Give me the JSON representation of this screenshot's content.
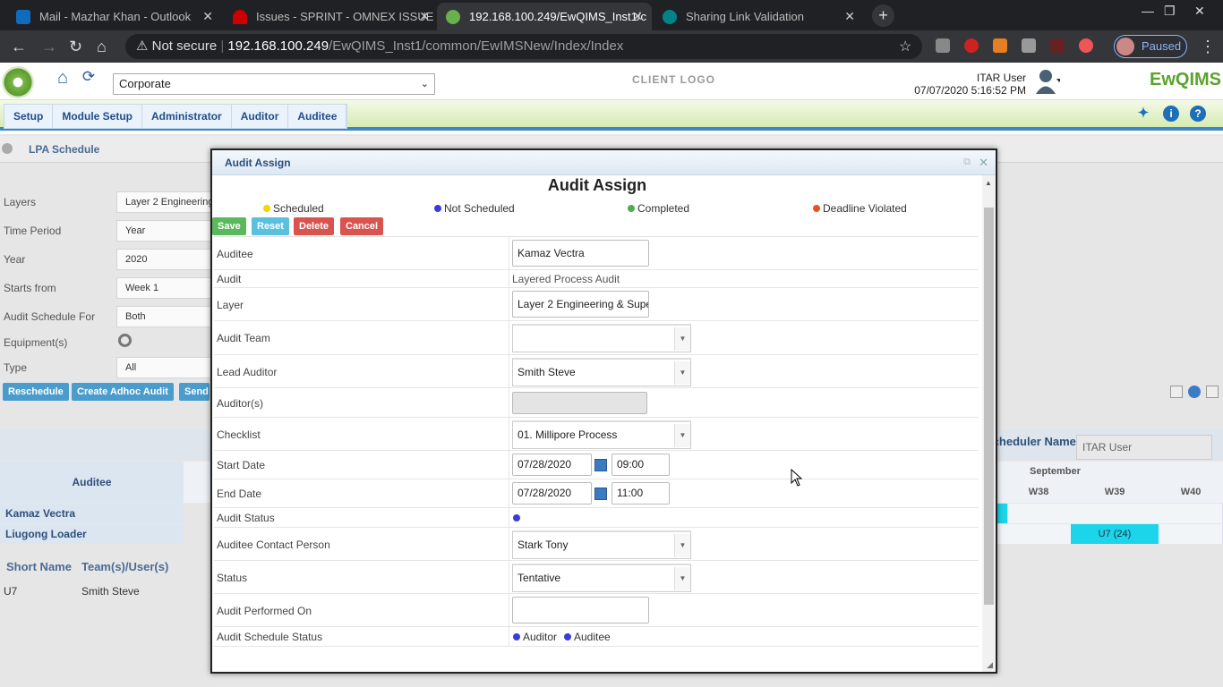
{
  "browser": {
    "tabs": [
      {
        "title": "Mail - Mazhar Khan - Outlook",
        "color": "#0f6cbd"
      },
      {
        "title": "Issues - SPRINT - OMNEX ISSUE",
        "color": "#c00"
      },
      {
        "title": "192.168.100.249/EwQIMS_Inst1/c",
        "color": "#6ab04c"
      },
      {
        "title": "Sharing Link Validation",
        "color": "#038387"
      }
    ],
    "security": "Not secure",
    "url_host": "192.168.100.249",
    "url_path": "/EwQIMS_Inst1/common/EwIMSNew/Index/Index",
    "paused": "Paused"
  },
  "app": {
    "site_select": "Corporate",
    "client_logo": "CLIENT LOGO",
    "user_name": "ITAR User",
    "datetime": "07/07/2020 5:16:52 PM",
    "brand": "EwQIMS",
    "menu": [
      "Setup",
      "Module Setup",
      "Administrator",
      "Auditor",
      "Auditee"
    ]
  },
  "page": {
    "title": "LPA Schedule",
    "filters": [
      {
        "label": "Layers",
        "value": "Layer 2 Engineering"
      },
      {
        "label": "Time Period",
        "value": "Year"
      },
      {
        "label": "Year",
        "value": "2020"
      },
      {
        "label": "Starts from",
        "value": "Week 1"
      },
      {
        "label": "Audit Schedule For",
        "value": "Both"
      },
      {
        "label": "Equipment(s)",
        "value": ""
      },
      {
        "label": "Type",
        "value": "All"
      }
    ],
    "buttons": [
      "Reschedule",
      "Create Adhoc Audit",
      "Send"
    ],
    "scheduler_label": "Scheduler Name",
    "scheduler_value": "ITAR User",
    "grid": {
      "auditee_header": "Auditee",
      "month": "September",
      "weeks": [
        "W38",
        "W39",
        "W40"
      ],
      "rows": [
        "Kamaz Vectra",
        "Liugong Loader"
      ],
      "cell": "U7 (24)"
    },
    "short_table": {
      "headers": [
        "Short Name",
        "Team(s)/User(s)"
      ],
      "row": [
        "U7",
        "Smith Steve"
      ]
    }
  },
  "modal": {
    "title": "Audit Assign",
    "heading": "Audit Assign",
    "legend": [
      {
        "label": "Scheduled",
        "color": "#f2d600"
      },
      {
        "label": "Not Scheduled",
        "color": "#3b3bd6"
      },
      {
        "label": "Completed",
        "color": "#4caf50"
      },
      {
        "label": "Deadline Violated",
        "color": "#e8541c"
      }
    ],
    "buttons": {
      "save": "Save",
      "reset": "Reset",
      "delete": "Delete",
      "cancel": "Cancel"
    },
    "fields": {
      "auditee": {
        "label": "Auditee",
        "value": "Kamaz Vectra"
      },
      "audit": {
        "label": "Audit",
        "value": "Layered Process Audit"
      },
      "layer": {
        "label": "Layer",
        "value": "Layer 2 Engineering & Supe"
      },
      "audit_team": {
        "label": "Audit Team",
        "value": ""
      },
      "lead_auditor": {
        "label": "Lead Auditor",
        "value": "Smith Steve"
      },
      "auditors": {
        "label": "Auditor(s)",
        "value": ""
      },
      "checklist": {
        "label": "Checklist",
        "value": "01. Millipore Process"
      },
      "start_date": {
        "label": "Start Date",
        "date": "07/28/2020",
        "time": "09:00"
      },
      "end_date": {
        "label": "End Date",
        "date": "07/28/2020",
        "time": "11:00"
      },
      "audit_status": {
        "label": "Audit Status"
      },
      "contact": {
        "label": "Auditee Contact Person",
        "value": "Stark Tony"
      },
      "status": {
        "label": "Status",
        "value": "Tentative"
      },
      "performed_on": {
        "label": "Audit Performed On",
        "value": ""
      },
      "schedule_status": {
        "label": "Audit Schedule Status",
        "auditor": "Auditor",
        "auditee": "Auditee"
      }
    }
  }
}
